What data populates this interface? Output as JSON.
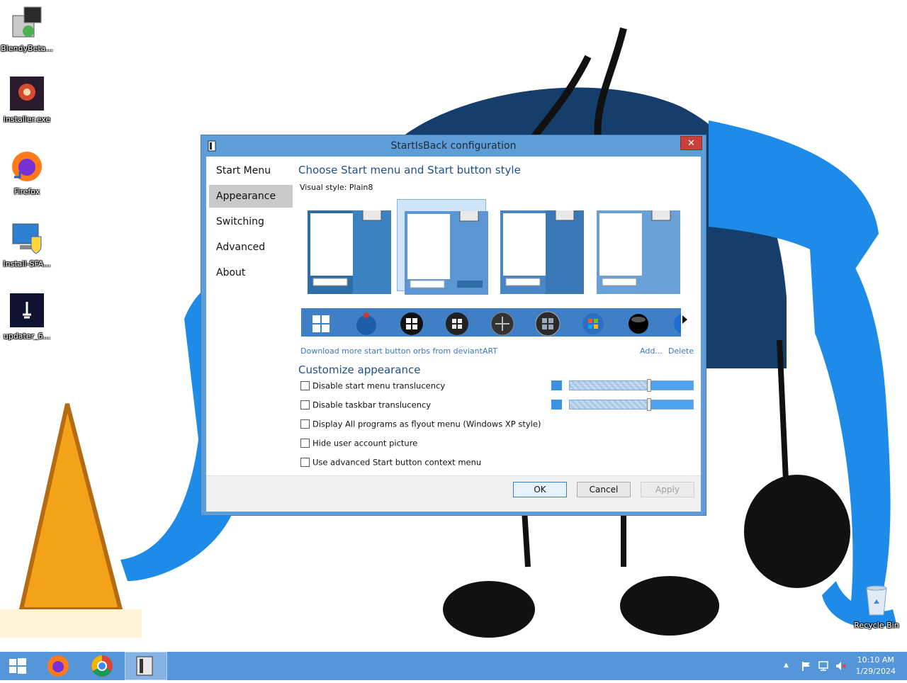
{
  "desktop": {
    "icons": [
      {
        "label": "BlendyBeta..."
      },
      {
        "label": "installer.exe"
      },
      {
        "label": "Firefox"
      },
      {
        "label": "Install-SFA..."
      },
      {
        "label": "updater_6..."
      }
    ],
    "recycle_bin": {
      "label": "Recycle Bin"
    }
  },
  "dialog": {
    "title": "StartIsBack configuration",
    "close_label": "✕",
    "nav": [
      {
        "label": "Start Menu"
      },
      {
        "label": "Appearance"
      },
      {
        "label": "Switching"
      },
      {
        "label": "Advanced"
      },
      {
        "label": "About"
      }
    ],
    "active_nav": "Appearance",
    "style_section_title": "Choose Start menu and Start button style",
    "visual_style_label": "Visual style:",
    "visual_style_value": "Plain8",
    "orb_links": {
      "download": "Download more start button orbs from deviantART",
      "add": "Add...",
      "delete": "Delete"
    },
    "customize_title": "Customize appearance",
    "options": [
      {
        "label": "Disable start menu translucency",
        "checked": false
      },
      {
        "label": "Disable taskbar translucency",
        "checked": false
      },
      {
        "label": "Display All programs as flyout menu (Windows XP style)",
        "checked": false
      },
      {
        "label": "Hide user account picture",
        "checked": false
      },
      {
        "label": "Use advanced Start button context menu",
        "checked": false
      }
    ],
    "sliders": [
      {
        "level": 0.65,
        "color": "#3b93e0"
      },
      {
        "level": 0.65,
        "color": "#3b93e0"
      }
    ],
    "buttons": {
      "ok": "OK",
      "cancel": "Cancel",
      "apply": "Apply"
    }
  },
  "taskbar": {
    "time": "10:10 AM",
    "date": "1/29/2024",
    "tray_up_arrow": "▲"
  },
  "colors": {
    "accent": "#5596d8",
    "title_text": "#1e4f8f",
    "link": "#3a78c3"
  }
}
